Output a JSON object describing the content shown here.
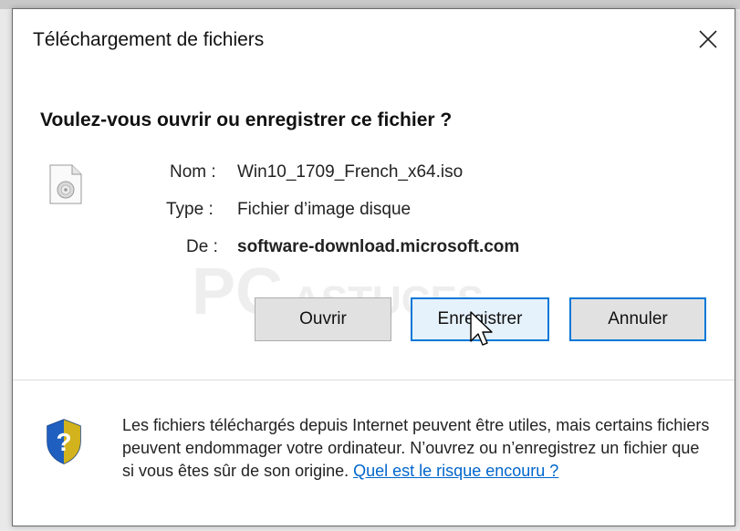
{
  "dialog": {
    "title": "Téléchargement de fichiers",
    "close_icon": "close-icon",
    "question": "Voulez-vous ouvrir ou enregistrer ce fichier ?"
  },
  "file": {
    "icon": "disc-image-file-icon",
    "name_label": "Nom :",
    "name_value": "Win10_1709_French_x64.iso",
    "type_label": "Type :",
    "type_value": "Fichier d’image disque",
    "from_label": "De :",
    "from_value": "software-download.microsoft.com"
  },
  "buttons": {
    "open": "Ouvrir",
    "save": "Enregistrer",
    "cancel": "Annuler"
  },
  "watermark": {
    "text_main": "PC",
    "text_sub": "ASTUCES"
  },
  "warning": {
    "icon": "shield-question-icon",
    "text": "Les fichiers téléchargés depuis Internet peuvent être utiles, mais certains fichiers peuvent endommager votre ordinateur. N’ouvrez ou n’enregistrez un fichier que si vous êtes sûr de son origine. ",
    "link": "Quel est le risque encouru ?"
  },
  "colors": {
    "accent": "#0078d7",
    "link": "#0066cc",
    "shield_blue": "#1f5fbf",
    "shield_yellow": "#f2c200"
  }
}
